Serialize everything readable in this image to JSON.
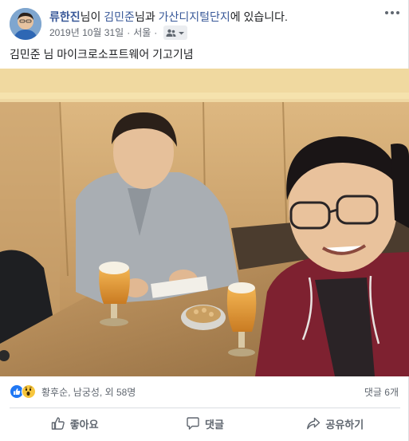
{
  "post": {
    "author": "류한진",
    "with_prefix": "님이 ",
    "tagged_person": "김민준",
    "at_prefix": "님과 ",
    "place": "가산디지털단지",
    "at_suffix": "에 있습니다.",
    "date": "2019년 10월 31일",
    "location": "서울",
    "audience_icon": "friends-icon",
    "caption": "김민준 님 마이크로소프트웨어 기고기념"
  },
  "reactions": {
    "icons": [
      "like-icon",
      "wow-icon"
    ],
    "summary": "황후순, 남궁성, 외 58명",
    "comments": "댓글 6개"
  },
  "actions": {
    "like": "좋아요",
    "comment": "댓글",
    "share": "공유하기"
  },
  "colors": {
    "link": "#385898",
    "meta": "#616770",
    "like_blue": "#2078f4",
    "wow_yellow": "#f7c63d"
  }
}
